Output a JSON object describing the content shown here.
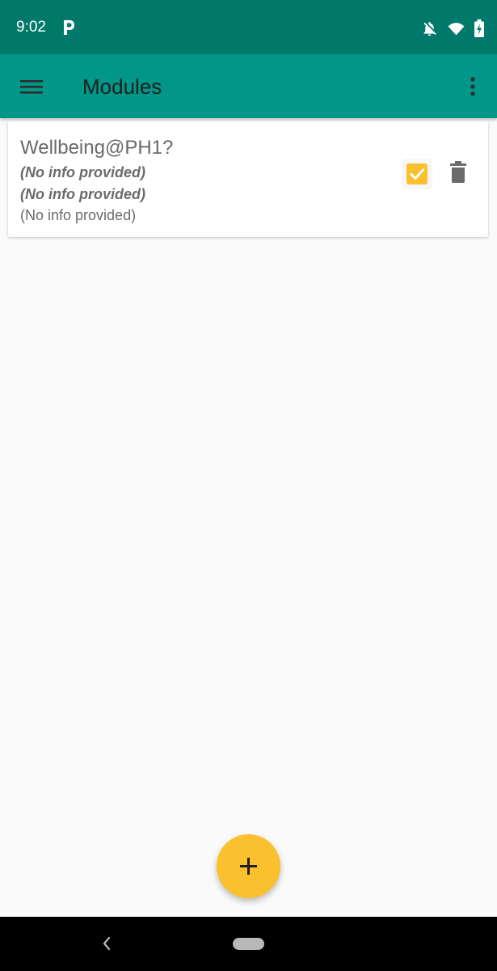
{
  "status_bar": {
    "time": "9:02",
    "icons": [
      "parking-p-icon",
      "notifications-off-icon",
      "wifi-icon",
      "battery-charging-icon"
    ],
    "colors": {
      "background": "#00796b",
      "foreground": "#ffffff"
    }
  },
  "app_bar": {
    "title": "Modules",
    "icons": [
      "menu-icon",
      "overflow-menu-icon"
    ],
    "colors": {
      "background": "#009688",
      "title": "#1f1f1f"
    }
  },
  "module_card": {
    "title": "Wellbeing@PH1?",
    "line1": "(No info provided)",
    "line2": "(No info provided)",
    "line3": "(No info provided)",
    "checkbox_checked": true,
    "icons": [
      "checkbox-checked-icon",
      "delete-icon"
    ],
    "colors": {
      "checkbox": "#fbc02d",
      "text": "#6b6b6b"
    }
  },
  "fab": {
    "icon": "add-icon",
    "color": "#fbc02d"
  },
  "navigation_bar": {
    "icons": [
      "back-chevron-icon",
      "home-pill-icon"
    ],
    "background": "#000000"
  }
}
